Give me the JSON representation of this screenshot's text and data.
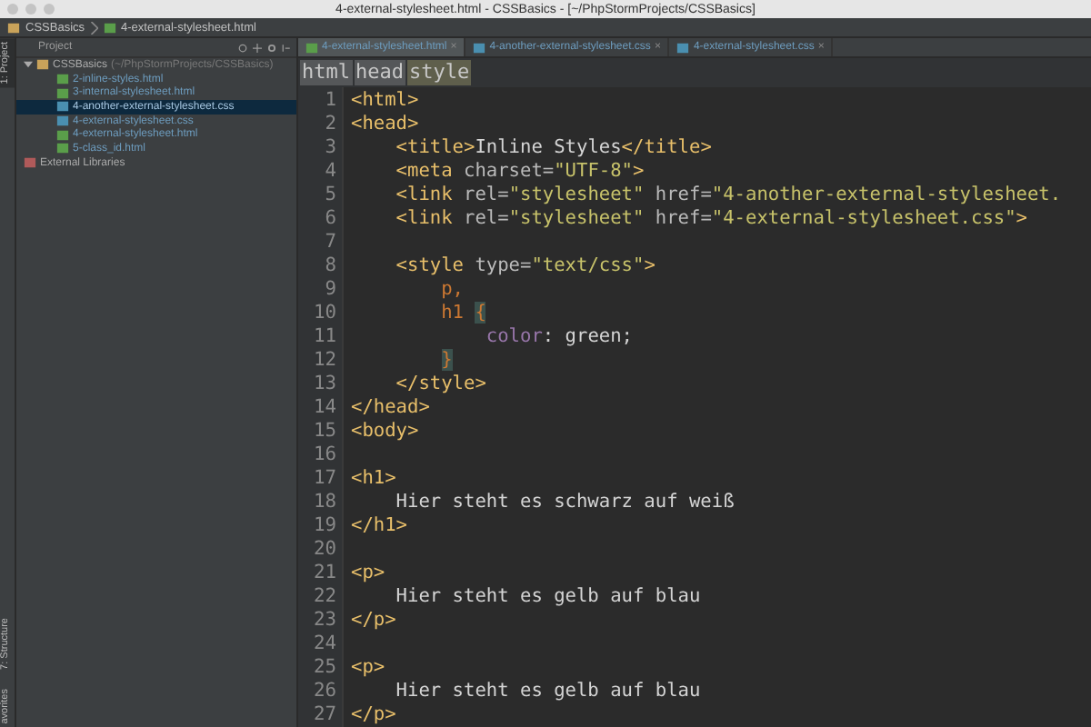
{
  "window": {
    "title": "4-external-stylesheet.html - CSSBasics - [~/PhpStormProjects/CSSBasics]"
  },
  "navigation_bar": [
    "CSSBasics",
    "4-external-stylesheet.html"
  ],
  "tool_strip": [
    "1: Project",
    "7: Structure",
    "avorites"
  ],
  "project_panel": {
    "title": "Project",
    "tree": [
      {
        "label": "CSSBasics",
        "path": "(~/PhpStormProjects/CSSBasics)",
        "kind": "folder",
        "selected": false,
        "expanded": true,
        "children": [
          {
            "label": "2-inline-styles.html",
            "kind": "html",
            "selected": false
          },
          {
            "label": "3-internal-stylesheet.html",
            "kind": "html",
            "selected": false
          },
          {
            "label": "4-another-external-stylesheet.css",
            "kind": "css",
            "selected": true
          },
          {
            "label": "4-external-stylesheet.css",
            "kind": "css",
            "selected": false
          },
          {
            "label": "4-external-stylesheet.html",
            "kind": "html",
            "selected": false
          },
          {
            "label": "5-class_id.html",
            "kind": "html",
            "selected": false
          }
        ]
      },
      {
        "label": "External Libraries",
        "kind": "library",
        "selected": false
      }
    ]
  },
  "editor_tabs": [
    {
      "label": "4-external-stylesheet.html",
      "kind": "html",
      "selected": true,
      "close": "×"
    },
    {
      "label": "4-another-external-stylesheet.css",
      "kind": "css",
      "selected": false,
      "close": "×"
    },
    {
      "label": "4-external-stylesheet.css",
      "kind": "css",
      "selected": false,
      "close": "×"
    }
  ],
  "breadcrumbs": [
    {
      "label": "html",
      "selected": false
    },
    {
      "label": "head",
      "selected": false
    },
    {
      "label": "style",
      "selected": true
    }
  ],
  "code_lines": [
    {
      "number": "1",
      "tokens": [
        {
          "kind": "tag",
          "text": "<html>"
        }
      ]
    },
    {
      "number": "2",
      "tokens": [
        {
          "kind": "tag",
          "text": "<head>"
        }
      ]
    },
    {
      "number": "3",
      "tokens": [
        {
          "kind": "tag",
          "text": "    <title>"
        },
        {
          "kind": "text",
          "text": "Inline Styles"
        },
        {
          "kind": "tag",
          "text": "</title>"
        }
      ]
    },
    {
      "number": "4",
      "tokens": [
        {
          "kind": "tag",
          "text": "    <meta "
        },
        {
          "kind": "attr",
          "text": "charset="
        },
        {
          "kind": "value",
          "text": "\"UTF-8\""
        },
        {
          "kind": "tag",
          "text": ">"
        }
      ]
    },
    {
      "number": "5",
      "tokens": [
        {
          "kind": "tag",
          "text": "    <link "
        },
        {
          "kind": "attr",
          "text": "rel="
        },
        {
          "kind": "value",
          "text": "\"stylesheet\" "
        },
        {
          "kind": "attr",
          "text": "href="
        },
        {
          "kind": "value",
          "text": "\"4-another-external-stylesheet."
        }
      ]
    },
    {
      "number": "6",
      "tokens": [
        {
          "kind": "tag",
          "text": "    <link "
        },
        {
          "kind": "attr",
          "text": "rel="
        },
        {
          "kind": "value",
          "text": "\"stylesheet\" "
        },
        {
          "kind": "attr",
          "text": "href="
        },
        {
          "kind": "value",
          "text": "\"4-external-stylesheet.css\""
        },
        {
          "kind": "tag",
          "text": ">"
        }
      ]
    },
    {
      "number": "7"
    },
    {
      "number": "8",
      "tokens": [
        {
          "kind": "tag",
          "text": "    <style "
        },
        {
          "kind": "attr",
          "text": "type="
        },
        {
          "kind": "value",
          "text": "\"text/css\""
        },
        {
          "kind": "tag",
          "text": ">"
        }
      ]
    },
    {
      "number": "9",
      "tokens": [
        {
          "kind": "selector",
          "text": "        p,"
        }
      ]
    },
    {
      "number": "10",
      "tokens": [
        {
          "kind": "selector",
          "text": "        h1 "
        },
        {
          "kind": "brace",
          "text": "{"
        }
      ]
    },
    {
      "number": "11",
      "tokens": [
        {
          "kind": "prop",
          "text": "            color"
        },
        {
          "kind": "text",
          "text": ": green;"
        }
      ]
    },
    {
      "number": "12",
      "tokens": [
        {
          "kind": "brace",
          "text": "        }"
        }
      ]
    },
    {
      "number": "13",
      "tokens": [
        {
          "kind": "tag",
          "text": "    </style>"
        }
      ]
    },
    {
      "number": "14",
      "tokens": [
        {
          "kind": "tag",
          "text": "</head>"
        }
      ]
    },
    {
      "number": "15",
      "tokens": [
        {
          "kind": "tag",
          "text": "<body>"
        }
      ]
    },
    {
      "number": "16"
    },
    {
      "number": "17",
      "tokens": [
        {
          "kind": "tag",
          "text": "<h1>"
        }
      ]
    },
    {
      "number": "18",
      "tokens": [
        {
          "kind": "text",
          "text": "    Hier steht es schwarz auf weiß"
        }
      ]
    },
    {
      "number": "19",
      "tokens": [
        {
          "kind": "tag",
          "text": "</h1>"
        }
      ]
    },
    {
      "number": "20"
    },
    {
      "number": "21",
      "tokens": [
        {
          "kind": "tag",
          "text": "<p>"
        }
      ]
    },
    {
      "number": "22",
      "tokens": [
        {
          "kind": "text",
          "text": "    Hier steht es gelb auf blau"
        }
      ]
    },
    {
      "number": "23",
      "tokens": [
        {
          "kind": "tag",
          "text": "</p>"
        }
      ]
    },
    {
      "number": "24"
    },
    {
      "number": "25",
      "tokens": [
        {
          "kind": "tag",
          "text": "<p>"
        }
      ]
    },
    {
      "number": "26",
      "tokens": [
        {
          "kind": "text",
          "text": "    Hier steht es gelb auf blau"
        }
      ]
    },
    {
      "number": "27",
      "tokens": [
        {
          "kind": "tag",
          "text": "</p>"
        }
      ]
    }
  ]
}
